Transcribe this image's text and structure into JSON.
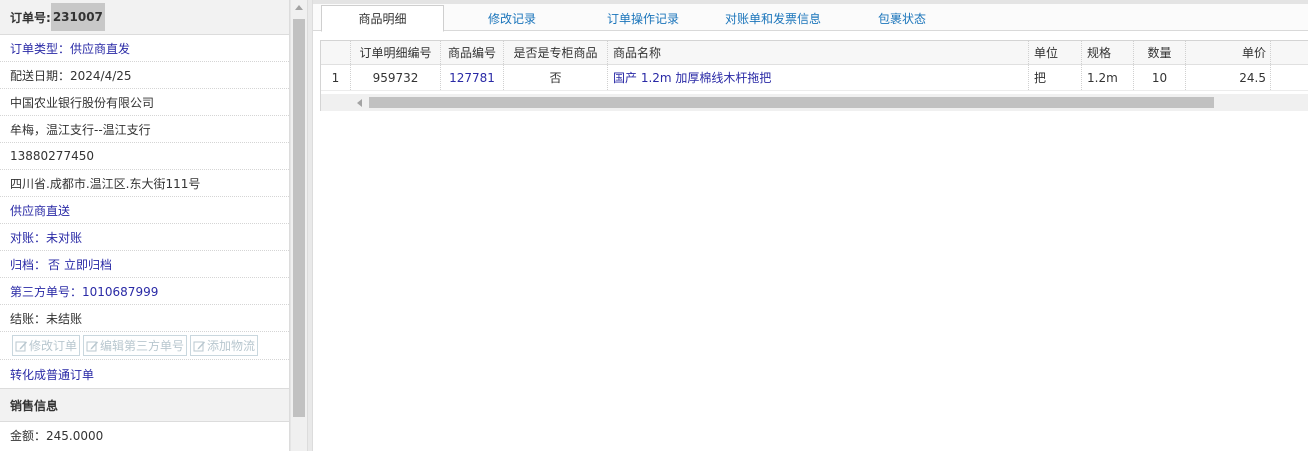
{
  "order": {
    "number_label": "订单号:",
    "number_value": "231007",
    "type": "订单类型：供应商直发",
    "delivery_date": "配送日期：2024/4/25",
    "company": "中国农业银行股份有限公司",
    "contact": "牟梅，温江支行--温江支行",
    "phone": "13880277450",
    "address": "四川省.成都市.温江区.东大街111号",
    "supply": "供应商直送",
    "reconcile": "对账：未对账",
    "archive_label": "归档：",
    "archive_value": "否",
    "archive_link": "立即归档",
    "third_party": "第三方单号：1010687999",
    "settlement": "结账：未结账"
  },
  "actions": {
    "edit_order": "修改订单",
    "edit_third_party": "编辑第三方单号",
    "add_logistics": "添加物流",
    "convert": "转化成普通订单"
  },
  "sales": {
    "header": "销售信息",
    "amount": "金额：245.0000"
  },
  "tabs": [
    "商品明细",
    "修改记录",
    "订单操作记录",
    "对账单和发票信息",
    "包裹状态"
  ],
  "grid": {
    "headers": [
      "订单明细编号",
      "商品编号",
      "是否是专柜商品",
      "商品名称",
      "单位",
      "规格",
      "数量",
      "单价"
    ],
    "rows": [
      {
        "index": "1",
        "detail_id": "959732",
        "product_id": "127781",
        "is_counter": "否",
        "name": "国产 1.2m 加厚棉线木杆拖把",
        "unit": "把",
        "spec": "1.2m",
        "qty": "10",
        "price": "24.5"
      }
    ]
  },
  "colors": {
    "link": "#2a2aa6",
    "tab_link": "#1b75bb",
    "disabled": "#b8c7cf"
  }
}
